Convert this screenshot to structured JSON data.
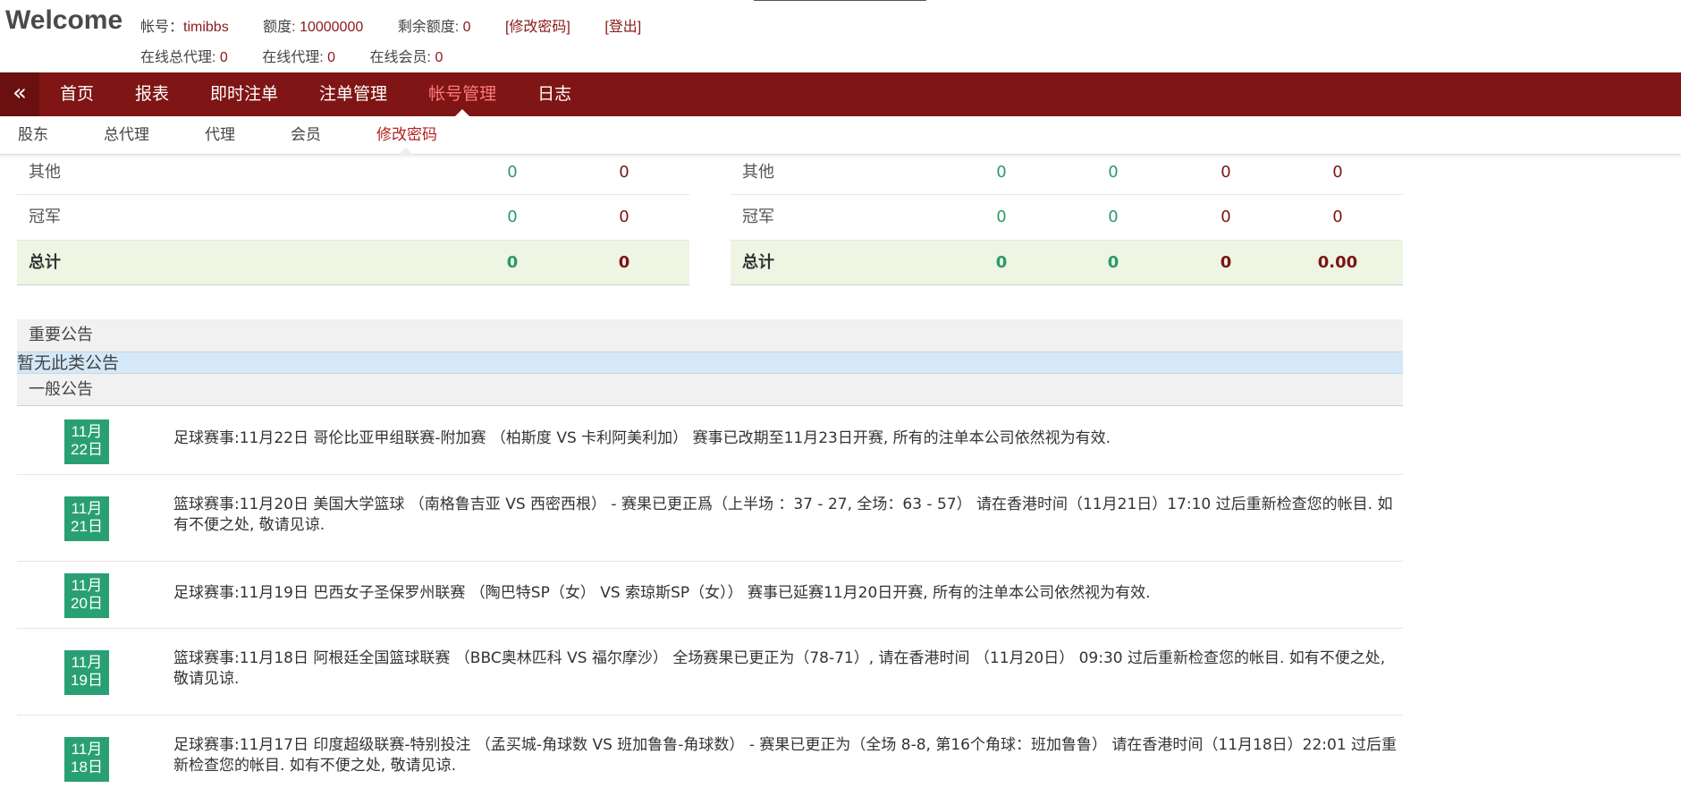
{
  "header": {
    "welcome": "Welcome",
    "account_label": "帐号：",
    "account": "timibbs",
    "quota_label": "额度: ",
    "quota": "10000000",
    "remain_label": "剩余额度: ",
    "remain": "0",
    "change_pwd": "[修改密码]",
    "logout": "[登出]",
    "online_gen_agent_label": "在线总代理: ",
    "online_gen_agent": "0",
    "online_agent_label": "在线代理: ",
    "online_agent": "0",
    "online_member_label": "在线会员: ",
    "online_member": "0"
  },
  "nav": {
    "toggle": "«",
    "items": [
      "首页",
      "报表",
      "即时注单",
      "注单管理",
      "帐号管理",
      "日志"
    ],
    "active_index": 4
  },
  "subnav": {
    "items": [
      "股东",
      "总代理",
      "代理",
      "会员",
      "修改密码"
    ],
    "active_index": 4
  },
  "table_left": {
    "rows": [
      {
        "label": "其他",
        "values": [
          "0",
          "0"
        ]
      },
      {
        "label": "冠军",
        "values": [
          "0",
          "0"
        ]
      },
      {
        "label": "总计",
        "values": [
          "0",
          "0"
        ]
      }
    ]
  },
  "table_right": {
    "rows": [
      {
        "label": "其他",
        "values": [
          "0",
          "0",
          "0",
          "0"
        ]
      },
      {
        "label": "冠军",
        "values": [
          "0",
          "0",
          "0",
          "0"
        ]
      },
      {
        "label": "总计",
        "values": [
          "0",
          "0",
          "0",
          "0.00"
        ]
      }
    ]
  },
  "notices": {
    "important_title": "重要公告",
    "important_empty": "暂无此类公告",
    "general_title": "一般公告",
    "items": [
      {
        "month": "11月",
        "day": "22日",
        "text": "足球赛事:11月22日 哥伦比亚甲组联赛-附加赛 （柏斯度 VS 卡利阿美利加） 赛事已改期至11月23日开赛, 所有的注单本公司依然视为有效."
      },
      {
        "month": "11月",
        "day": "21日",
        "text": "篮球赛事:11月20日 美国大学篮球 （南格鲁吉亚 VS 西密西根） - 赛果已更正爲（上半场 ：37 - 27, 全场：63 - 57） 请在香港时间（11月21日）17:10 过后重新检查您的帐目. 如有不便之处, 敬请见谅."
      },
      {
        "month": "11月",
        "day": "20日",
        "text": "足球赛事:11月19日 巴西女子圣保罗州联赛 （陶巴特SP（女） VS 索琼斯SP（女）） 赛事已延赛11月20日开赛, 所有的注单本公司依然视为有效."
      },
      {
        "month": "11月",
        "day": "19日",
        "text": "篮球赛事:11月18日 阿根廷全国篮球联赛 （BBC奥林匹科 VS 福尔摩沙） 全场赛果已更正为（78-71）, 请在香港时间 （11月20日） 09:30 过后重新检查您的帐目. 如有不便之处, 敬请见谅."
      },
      {
        "month": "11月",
        "day": "18日",
        "text": "足球赛事:11月17日 印度超级联赛-特别投注 （孟买城-角球数 VS 班加鲁鲁-角球数） - 赛果已更正为（全场 8-8, 第16个角球：班加鲁鲁） 请在香港时间（11月18日）22:01 过后重新检查您的帐目. 如有不便之处, 敬请见谅."
      }
    ]
  }
}
